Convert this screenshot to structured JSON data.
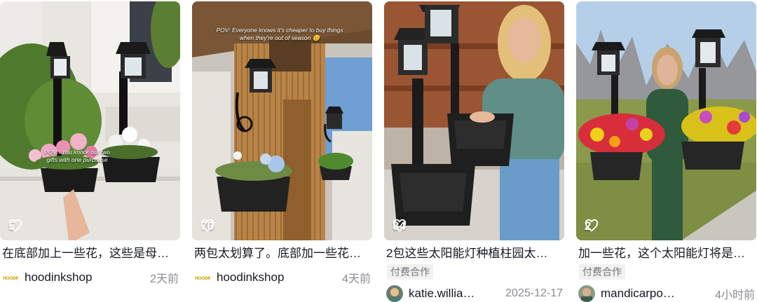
{
  "cards": [
    {
      "likes": "5",
      "overlay": "POV : You knock out two gifts with one purchase",
      "title": "在底部加上一些花，这些是母…",
      "paid_label": "",
      "author": "hoodinkshop",
      "brand_logo_text": "HOODINK",
      "date": "2天前"
    },
    {
      "likes": "76",
      "overlay": "POV: Everyone knows it's cheaper to buy things when they're out of season 😊",
      "title": "两包太划算了。底部加一些花…",
      "paid_label": "",
      "author": "hoodinkshop",
      "brand_logo_text": "HOODINK",
      "date": "4天前"
    },
    {
      "likes": "84",
      "overlay": "",
      "title": "2包这些太阳能灯种植柱园太…",
      "paid_label": "付费合作",
      "author": "katie.willia…",
      "date": "2025-12-17"
    },
    {
      "likes": "2",
      "overlay": "",
      "title": "加一些花，这个太阳能灯将是…",
      "paid_label": "付费合作",
      "author": "mandicarpo…",
      "date": "4小时前"
    }
  ],
  "icons": {
    "like": "heart-outline-icon"
  },
  "colors": {
    "brand_logo": "#c9a300",
    "meta_gray": "#8a8b91",
    "paid_bg": "#f1f1f2"
  }
}
